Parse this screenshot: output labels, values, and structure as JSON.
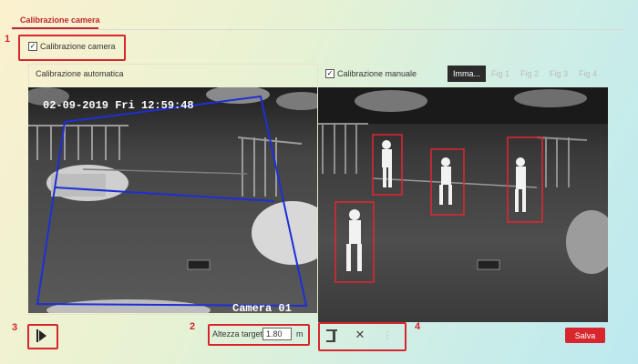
{
  "tab": {
    "label": "Calibrazione camera"
  },
  "main_checkbox": {
    "label": "Calibrazione camera",
    "checked": true
  },
  "left_panel": {
    "title": "Calibrazione automatica",
    "osd_timestamp": "02-09-2019 Fri 12:59:48",
    "osd_camera": "Camera 01"
  },
  "right_panel": {
    "manual_label": "Calibrazione manuale",
    "manual_checked": true,
    "fig_tabs": [
      "Imma...",
      "Fig 1",
      "Fig 2",
      "Fig 3",
      "Fig 4"
    ],
    "active_fig_tab": 0
  },
  "markers": [
    "1",
    "2",
    "3",
    "4"
  ],
  "bottom": {
    "target_label": "Altezza target",
    "target_value": "1.80",
    "target_unit": "m",
    "save_label": "Salva"
  },
  "colors": {
    "accent": "#d7262d",
    "tab": "#c4262e",
    "calibration_box": "#1e2fd6",
    "person_box": "#e3262f"
  },
  "icons": {
    "play": "play-icon",
    "stand": "person-height-icon",
    "delete": "close-icon",
    "more": "more-vertical-icon"
  }
}
